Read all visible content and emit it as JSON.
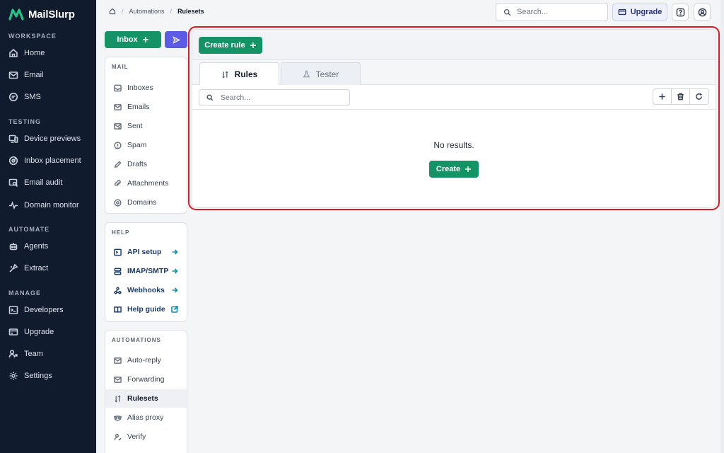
{
  "brand": {
    "name": "MailSlurp",
    "logo_color": "#27c48a"
  },
  "sidebar": {
    "sections": [
      {
        "title": "WORKSPACE",
        "items": [
          {
            "label": "Home",
            "icon": "home-icon"
          },
          {
            "label": "Email",
            "icon": "mail-icon"
          },
          {
            "label": "SMS",
            "icon": "chat-icon"
          }
        ]
      },
      {
        "title": "TESTING",
        "items": [
          {
            "label": "Device previews",
            "icon": "devices-icon"
          },
          {
            "label": "Inbox placement",
            "icon": "target-icon"
          },
          {
            "label": "Email audit",
            "icon": "audit-icon"
          },
          {
            "label": "Domain monitor",
            "icon": "pulse-icon"
          }
        ]
      },
      {
        "title": "AUTOMATE",
        "items": [
          {
            "label": "Agents",
            "icon": "robot-icon"
          },
          {
            "label": "Extract",
            "icon": "extract-icon"
          }
        ]
      },
      {
        "title": "MANAGE",
        "items": [
          {
            "label": "Developers",
            "icon": "terminal-icon"
          },
          {
            "label": "Upgrade",
            "icon": "card-icon"
          },
          {
            "label": "Team",
            "icon": "team-icon"
          },
          {
            "label": "Settings",
            "icon": "gear-icon"
          }
        ]
      }
    ]
  },
  "breadcrumb": {
    "items": [
      "Automations",
      "Rulesets"
    ]
  },
  "topbar": {
    "search_placeholder": "Search...",
    "upgrade_label": "Upgrade"
  },
  "actions": {
    "inbox_label": "Inbox"
  },
  "mail_panel": {
    "title": "MAIL",
    "items": [
      {
        "label": "Inboxes"
      },
      {
        "label": "Emails"
      },
      {
        "label": "Sent"
      },
      {
        "label": "Spam"
      },
      {
        "label": "Drafts"
      },
      {
        "label": "Attachments"
      },
      {
        "label": "Domains"
      }
    ]
  },
  "help_panel": {
    "title": "HELP",
    "items": [
      {
        "label": "API setup"
      },
      {
        "label": "IMAP/SMTP"
      },
      {
        "label": "Webhooks"
      },
      {
        "label": "Help guide"
      }
    ]
  },
  "automations_panel": {
    "title": "AUTOMATIONS",
    "items": [
      {
        "label": "Auto-reply"
      },
      {
        "label": "Forwarding"
      },
      {
        "label": "Rulesets"
      },
      {
        "label": "Alias proxy"
      },
      {
        "label": "Verify"
      }
    ]
  },
  "main": {
    "create_rule_label": "Create rule",
    "tabs": [
      {
        "label": "Rules",
        "active": true
      },
      {
        "label": "Tester",
        "active": false
      }
    ],
    "search_placeholder": "Search...",
    "empty_text": "No results.",
    "create_label": "Create"
  },
  "colors": {
    "accent_green": "#149367",
    "accent_purple": "#5b5be6",
    "sidebar_bg": "#111b2e",
    "highlight": "#d91b25"
  }
}
